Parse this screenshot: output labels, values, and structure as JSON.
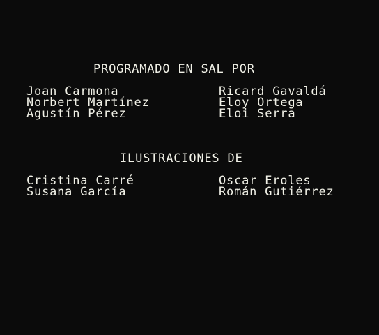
{
  "programming": {
    "heading": "PROGRAMADO EN SAL POR",
    "left": [
      "Joan Carmona",
      "Norbert Martínez",
      "Agustín Pérez"
    ],
    "right": [
      "Ricard Gavaldá",
      "Eloy Ortega",
      "Eloi Serra"
    ]
  },
  "illustrations": {
    "heading": "ILUSTRACIONES DE",
    "left": [
      "Cristina Carré",
      "Susana García"
    ],
    "right": [
      "Oscar Eroles",
      "Román Gutiérrez"
    ]
  },
  "colors": {
    "background": "#0b0b0b",
    "text": "#f0f0e6"
  }
}
